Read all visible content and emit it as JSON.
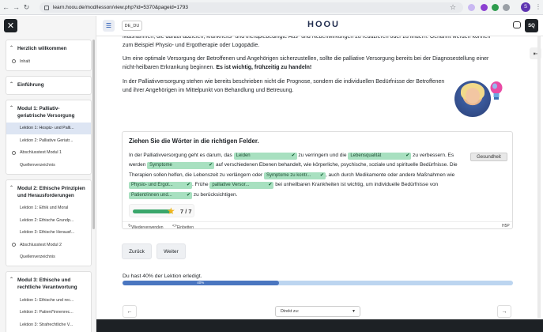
{
  "browser": {
    "url": "learn.hoou.de/mod/lesson/view.php?id=5370&pageid=1793",
    "profile_initial": "S"
  },
  "navbar": {
    "language": "DE_DU",
    "logo": "HOOU",
    "user_initials": "SQ"
  },
  "sidebar": {
    "sections": [
      {
        "title": "Herzlich willkommen",
        "items": [
          {
            "label": "Inhalt",
            "circle": true
          }
        ]
      },
      {
        "title": "Einführung",
        "items": []
      },
      {
        "title": "Modul 1: Palliativ-geriatrische Versorgung",
        "items": [
          {
            "label": "Lektion 1: Hospiz- und Palli...",
            "circle": false,
            "active": true
          },
          {
            "label": "Lektion 2: Palliative Geriatr...",
            "circle": false
          },
          {
            "label": "Abschlusstest Modul 1",
            "circle": true
          },
          {
            "label": "Quellenverzeichnis",
            "circle": false
          }
        ]
      },
      {
        "title": "Modul 2: Ethische Prinzipien und Herausforderungen",
        "items": [
          {
            "label": "Lektion 1: Ethik und Moral",
            "circle": false
          },
          {
            "label": "Lektion 2: Ethische Grundp...",
            "circle": false
          },
          {
            "label": "Lektion 3: Ethische Herausf...",
            "circle": false
          },
          {
            "label": "Abschlusstest Modul 2",
            "circle": true
          },
          {
            "label": "Quellenverzeichnis",
            "circle": false
          }
        ]
      },
      {
        "title": "Modul 3: Ethische und rechtliche Verantwortung",
        "items": [
          {
            "label": "Lektion 1: Ethische und rec...",
            "circle": false
          },
          {
            "label": "Lektion 2: Patient*innenrec...",
            "circle": false
          },
          {
            "label": "Lektion 3: Strafrechtliche V...",
            "circle": false
          }
        ]
      }
    ]
  },
  "content": {
    "p1": "Maßnahmen, die darauf abzielen, krankheits- und therapiebedingte Aus- und Nebenwirkungen zu reduzieren oder zu lindern. Genannt werden können zum Beispiel Physio- und Ergotherapie oder Logopädie.",
    "p2_a": "Um eine optimale Versorgung der Betroffenen und Angehörigen sicherzustellen, sollte die palliative Versorgung bereits bei der Diagnosestellung einer nicht-heilbaren Erkrankung beginnen.",
    "p2_b": "Es ist wichtig, frühzeitig zu handeln!",
    "p3": "In der Palliativversorgung stehen wie bereits beschrieben nicht die Prognose, sondern die individuellen Bedürfnisse der Betroffenen und ihrer Angehörigen im Mittelpunkt von Behandlung und Betreuung."
  },
  "h5p": {
    "title": "Ziehen Sie die Wörter in die richtigen Felder.",
    "t1": "In der Palliativversorgung geht es darum, das",
    "d1": "Leiden",
    "t2": "zu verringern und die",
    "d2": "Lebensqualität",
    "t3": "zu verbessern. Es werden",
    "d3": "Symptome",
    "t4": "auf verschiedenen Ebenen behandelt, wie körperliche, psychische, soziale und spirituelle Bedürfnisse. Die Therapien sollen helfen, die Lebenszeit zu verlängern oder",
    "d4": "Symptome zu kontr...",
    "t5": ", auch durch Medikamente oder andere Maßnahmen wie",
    "d5": "Physio- und Ergot...",
    "t6": ". Frühe",
    "d6": "palliative Versor...",
    "t7": "bei unheilbaren Krankheiten ist wichtig, um individuelle Bedürfnisse von",
    "d7": "Patient/innen und...",
    "t8": "zu berücksichtigen.",
    "extra_word": "Gesundheit",
    "score": "7 / 7",
    "score_fraction": 1.0,
    "reuse": "Wiederverwenden",
    "embed": "Einbetten",
    "h5p_label": "H5P"
  },
  "buttons": {
    "back": "Zurück",
    "next": "Weiter"
  },
  "progress": {
    "text": "Du hast 40% der Lektion erledigt.",
    "label": "40%",
    "value": 0.4
  },
  "pager": {
    "jump": "Direkt zu:"
  }
}
